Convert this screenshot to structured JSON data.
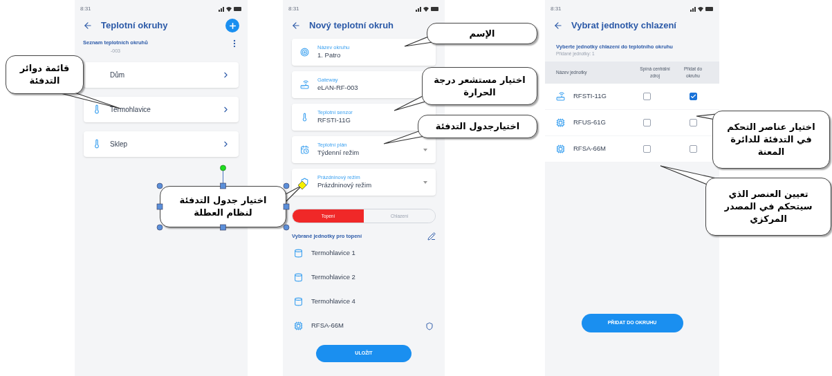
{
  "screens": [
    {
      "time": "8:31",
      "title": "Teplotní okruhy",
      "subtitle": "Seznam teplotních okruhů",
      "gateway_fragment": "-003",
      "circuits": [
        {
          "name": "Dům",
          "icon": false
        },
        {
          "name": "Termohlavice",
          "icon": true
        },
        {
          "name": "Sklep",
          "icon": true
        }
      ]
    },
    {
      "time": "8:31",
      "title": "Nový teplotní okruh",
      "fields": [
        {
          "label": "Název okruhu",
          "value": "1. Patro",
          "kind": "text"
        },
        {
          "label": "Gateway",
          "value": "eLAN-RF-003",
          "kind": "text"
        },
        {
          "label": "Teplotní senzor",
          "value": "RFSTI-11G",
          "kind": "text"
        },
        {
          "label": "Teplotní plán",
          "value": "Týdenní režim",
          "kind": "dropdown"
        },
        {
          "label": "Prázdninový režim",
          "value": "Prázdninový režim",
          "kind": "dropdown"
        }
      ],
      "modes": [
        {
          "label": "Topení",
          "selected": true
        },
        {
          "label": "Chlazení",
          "selected": false
        }
      ],
      "section": "Vybrané jednotky pro topení",
      "units": [
        {
          "name": "Termohlavice 1",
          "kind": "head"
        },
        {
          "name": "Termohlavice 2",
          "kind": "head"
        },
        {
          "name": "Termohlavice 4",
          "kind": "head"
        },
        {
          "name": "RFSA-66M",
          "kind": "switch",
          "central": true
        }
      ],
      "button": "ULOŽIT"
    },
    {
      "time": "8:31",
      "title": "Vybrat jednotky chlazení",
      "heading": "Vyberte jednotky chlazení do teplotního okruhu",
      "added": "Přidané jednotky: 1",
      "columns": [
        "Název jednotky",
        "Spíná centrální zdroj",
        "Přidat do okruhu"
      ],
      "rows": [
        {
          "name": "RFSTI-11G",
          "kind": "sensor",
          "central": false,
          "add": true
        },
        {
          "name": "RFUS-61G",
          "kind": "switch",
          "central": false,
          "add": false
        },
        {
          "name": "RFSA-66M",
          "kind": "switch",
          "central": false,
          "add": false
        }
      ],
      "button": "PŘIDAT DO OKRUHU"
    }
  ],
  "callouts": [
    {
      "text": "قائمة دوائر التدفئة",
      "selected": false
    },
    {
      "text": "اختيار جدول التدفئة لنظام العطلة",
      "selected": true
    },
    {
      "text": "الإسم",
      "selected": false
    },
    {
      "text": "اختيار مستشعر درجة الحرارة",
      "selected": false
    },
    {
      "text": "اختيار عناصر التحكم في التدفئة للدائرة المعنة",
      "selected": false
    },
    {
      "text": "اختيارجدول التدفئة",
      "selected": false
    },
    {
      "text": "تعيين العنصر الذي سيتحكم في المصدر المركزي",
      "selected": false
    }
  ]
}
